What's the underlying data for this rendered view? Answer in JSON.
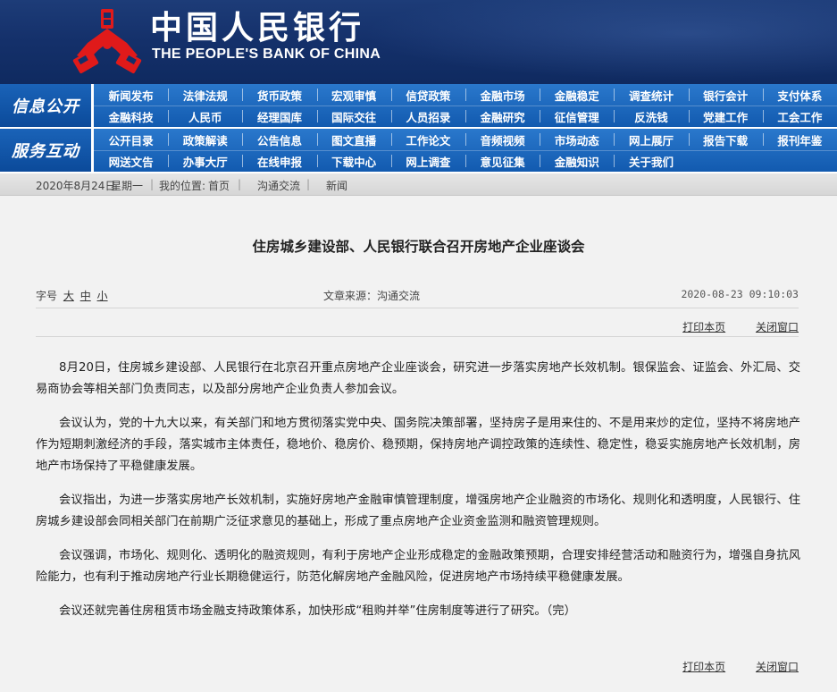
{
  "header": {
    "logo_cn": "中国人民银行",
    "logo_en": "THE PEOPLE'S BANK OF CHINA"
  },
  "nav": {
    "section1_label": "信息公开",
    "section2_label": "服务互动",
    "section1": [
      [
        "新闻发布",
        "法律法规",
        "货币政策",
        "宏观审慎",
        "信贷政策",
        "金融市场",
        "金融稳定",
        "调查统计",
        "银行会计",
        "支付体系"
      ],
      [
        "金融科技",
        "人民币",
        "经理国库",
        "国际交往",
        "人员招录",
        "金融研究",
        "征信管理",
        "反洗钱",
        "党建工作",
        "工会工作"
      ]
    ],
    "section2": [
      [
        "公开目录",
        "政策解读",
        "公告信息",
        "图文直播",
        "工作论文",
        "音频视频",
        "市场动态",
        "网上展厅",
        "报告下载",
        "报刊年鉴"
      ],
      [
        "网送文告",
        "办事大厅",
        "在线申报",
        "下载中心",
        "网上调查",
        "意见征集",
        "金融知识",
        "关于我们"
      ]
    ]
  },
  "breadcrumb": {
    "date": "2020年8月24日",
    "weekday": "星期一",
    "location_label": "我的位置:",
    "home": "首页",
    "level1": "沟通交流",
    "level2": "新闻"
  },
  "article": {
    "title": "住房城乡建设部、人民银行联合召开房地产企业座谈会",
    "font_size_label": "字号",
    "font_large": "大",
    "font_medium": "中",
    "font_small": "小",
    "source": "文章来源：沟通交流",
    "datetime": "2020-08-23 09:10:03",
    "print_label": "打印本页",
    "close_label": "关闭窗口",
    "paragraphs": [
      "8月20日，住房城乡建设部、人民银行在北京召开重点房地产企业座谈会，研究进一步落实房地产长效机制。银保监会、证监会、外汇局、交易商协会等相关部门负责同志，以及部分房地产企业负责人参加会议。",
      "会议认为，党的十九大以来，有关部门和地方贯彻落实党中央、国务院决策部署，坚持房子是用来住的、不是用来炒的定位，坚持不将房地产作为短期刺激经济的手段，落实城市主体责任，稳地价、稳房价、稳预期，保持房地产调控政策的连续性、稳定性，稳妥实施房地产长效机制，房地产市场保持了平稳健康发展。",
      "会议指出，为进一步落实房地产长效机制，实施好房地产金融审慎管理制度，增强房地产企业融资的市场化、规则化和透明度，人民银行、住房城乡建设部会同相关部门在前期广泛征求意见的基础上，形成了重点房地产企业资金监测和融资管理规则。",
      "会议强调，市场化、规则化、透明化的融资规则，有利于房地产企业形成稳定的金融政策预期，合理安排经营活动和融资行为，增强自身抗风险能力，也有利于推动房地产行业长期稳健运行，防范化解房地产金融风险，促进房地产市场持续平稳健康发展。",
      "会议还就完善住房租赁市场金融支持政策体系，加快形成“租购并举”住房制度等进行了研究。（完）"
    ]
  }
}
